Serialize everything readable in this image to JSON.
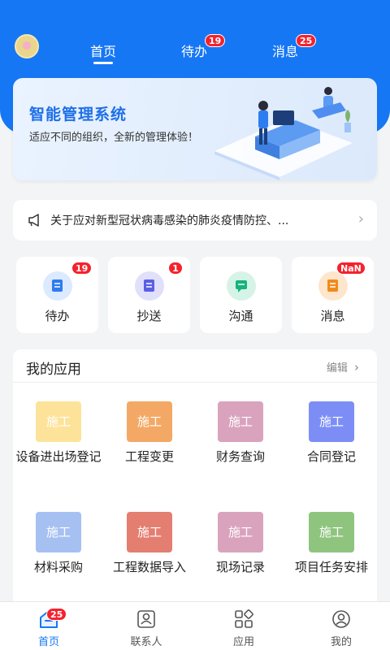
{
  "header": {
    "tabs": [
      {
        "label": "首页",
        "badge": null,
        "active": true
      },
      {
        "label": "待办",
        "badge": "19",
        "active": false
      },
      {
        "label": "消息",
        "badge": "25",
        "active": false
      }
    ]
  },
  "banner": {
    "title": "智能管理系统",
    "subtitle": "适应不同的组织，全新的管理体验！"
  },
  "notice": {
    "text": "关于应对新型冠状病毒感染的肺炎疫情防控、..."
  },
  "quick_actions": [
    {
      "label": "待办",
      "badge": "19",
      "icon": "todo-icon",
      "color": "#2f7bf0",
      "bg": "#dbeafe"
    },
    {
      "label": "抄送",
      "badge": "1",
      "icon": "cc-icon",
      "color": "#5b5fe6",
      "bg": "#e0e0fb"
    },
    {
      "label": "沟通",
      "badge": null,
      "icon": "chat-icon",
      "color": "#16b37d",
      "bg": "#d6f3e8"
    },
    {
      "label": "消息",
      "badge": "NaN",
      "icon": "message-icon",
      "color": "#f08a1c",
      "bg": "#fde6cc"
    }
  ],
  "apps": {
    "title": "我的应用",
    "edit_label": "编辑",
    "items": [
      {
        "label": "设备进出场登记",
        "icon_text": "施工",
        "color": "#fde39a"
      },
      {
        "label": "工程变更",
        "icon_text": "施工",
        "color": "#f3a965"
      },
      {
        "label": "财务查询",
        "icon_text": "施工",
        "color": "#d9a3bd"
      },
      {
        "label": "合同登记",
        "icon_text": "施工",
        "color": "#7c8ef5"
      },
      {
        "label": "材料采购",
        "icon_text": "施工",
        "color": "#a6c0f2"
      },
      {
        "label": "工程数据导入",
        "icon_text": "施工",
        "color": "#e47e70"
      },
      {
        "label": "现场记录",
        "icon_text": "施工",
        "color": "#d9a3bd"
      },
      {
        "label": "项目任务安排",
        "icon_text": "施工",
        "color": "#8fc47e"
      }
    ]
  },
  "bottom_nav": [
    {
      "label": "首页",
      "badge": "25",
      "icon": "home-icon",
      "active": true
    },
    {
      "label": "联系人",
      "badge": null,
      "icon": "contacts-icon",
      "active": false
    },
    {
      "label": "应用",
      "badge": null,
      "icon": "apps-grid-icon",
      "active": false
    },
    {
      "label": "我的",
      "badge": null,
      "icon": "profile-icon",
      "active": false
    }
  ],
  "colors": {
    "primary": "#1677f5",
    "badge": "#f5222d",
    "background": "#f3f4f6"
  }
}
